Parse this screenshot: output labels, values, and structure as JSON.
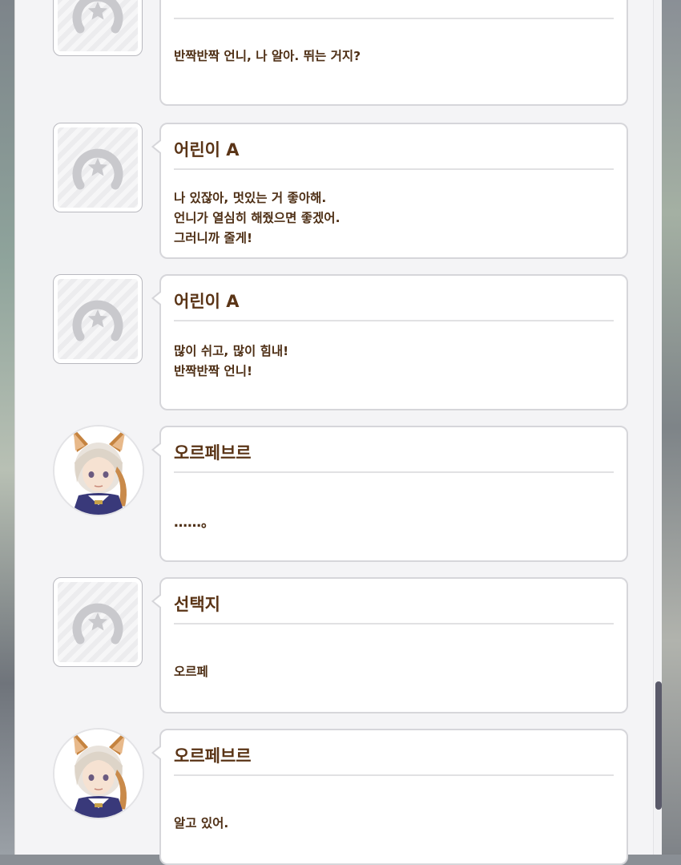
{
  "messages": [
    {
      "speaker": "",
      "avatar": "horseshoe-star-icon",
      "lines": [
        "반짝반짝 언니, 나 알아. 뛰는 거지?"
      ]
    },
    {
      "speaker": "어린이 A",
      "avatar": "horseshoe-star-icon",
      "lines": [
        "나 있잖아, 멋있는 거 좋아해.",
        "언니가 열심히 해줬으면 좋겠어.",
        "그러니까 줄게!"
      ]
    },
    {
      "speaker": "어린이 A",
      "avatar": "horseshoe-star-icon",
      "lines": [
        "많이 쉬고, 많이 힘내!",
        "반짝반짝 언니!"
      ]
    },
    {
      "speaker": "오르페브르",
      "avatar": "character-portrait",
      "lines": [
        "……。"
      ]
    },
    {
      "speaker": "선택지",
      "avatar": "horseshoe-star-icon",
      "lines": [
        "오르페"
      ]
    },
    {
      "speaker": "오르페브르",
      "avatar": "character-portrait",
      "lines": [
        "알고 있어."
      ]
    }
  ],
  "colors": {
    "speaker_text": "#5a3416",
    "body_text": "#4e2f15",
    "bubble_border": "#d6d6da",
    "panel_bg": "#f4f4f6",
    "scroll_thumb": "#5a5a6a"
  }
}
